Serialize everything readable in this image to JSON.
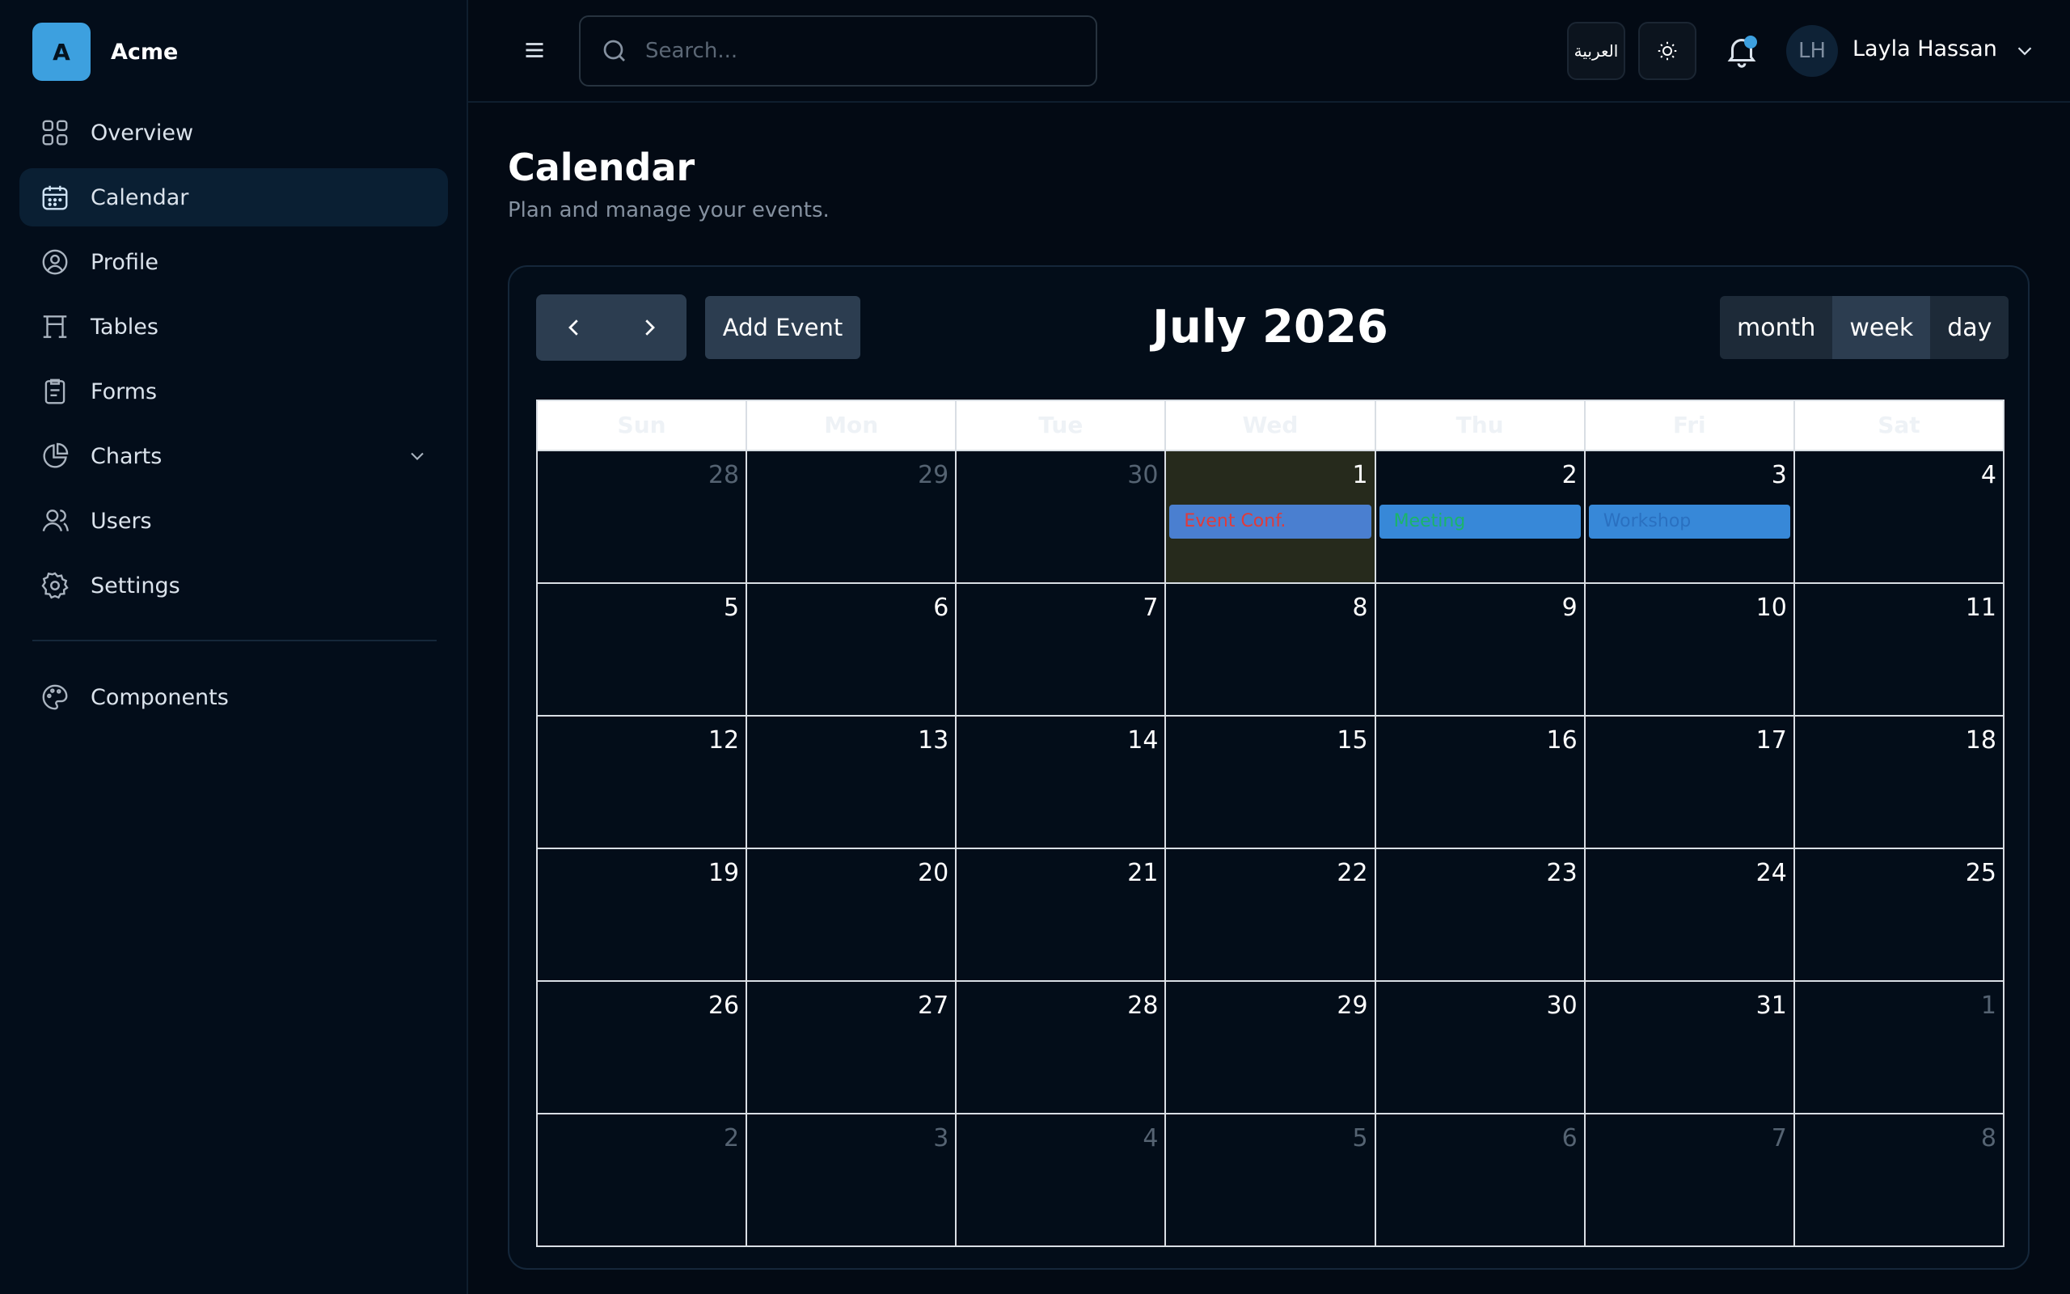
{
  "brand": {
    "logo_letter": "A",
    "name": "Acme",
    "color": "#3da0df"
  },
  "sidebar": {
    "items": [
      {
        "label": "Overview",
        "icon": "grid-icon"
      },
      {
        "label": "Calendar",
        "icon": "calendar-icon",
        "active": true
      },
      {
        "label": "Profile",
        "icon": "user-circle-icon"
      },
      {
        "label": "Tables",
        "icon": "table-icon"
      },
      {
        "label": "Forms",
        "icon": "clipboard-icon"
      },
      {
        "label": "Charts",
        "icon": "pie-chart-icon",
        "expandable": true
      },
      {
        "label": "Users",
        "icon": "users-icon"
      },
      {
        "label": "Settings",
        "icon": "gear-icon"
      }
    ],
    "secondary": [
      {
        "label": "Components",
        "icon": "palette-icon"
      }
    ]
  },
  "header": {
    "search_placeholder": "Search...",
    "language_label": "العربية",
    "theme_icon": "sun-icon",
    "notification_icon": "bell-icon",
    "avatar_initials": "LH",
    "user_name": "Layla Hassan"
  },
  "page": {
    "title": "Calendar",
    "subtitle": "Plan and manage your events."
  },
  "calendar": {
    "add_event_label": "Add Event",
    "month_title": "July 2026",
    "views": [
      "month",
      "week",
      "day"
    ],
    "active_view": "month",
    "weekdays": [
      "Sun",
      "Mon",
      "Tue",
      "Wed",
      "Thu",
      "Fri",
      "Sat"
    ],
    "weeks": [
      [
        {
          "n": "28",
          "other": true
        },
        {
          "n": "29",
          "other": true
        },
        {
          "n": "30",
          "other": true
        },
        {
          "n": "1",
          "today": true
        },
        {
          "n": "2"
        },
        {
          "n": "3"
        },
        {
          "n": "4"
        }
      ],
      [
        {
          "n": "5"
        },
        {
          "n": "6"
        },
        {
          "n": "7"
        },
        {
          "n": "8"
        },
        {
          "n": "9"
        },
        {
          "n": "10"
        },
        {
          "n": "11"
        }
      ],
      [
        {
          "n": "12"
        },
        {
          "n": "13"
        },
        {
          "n": "14"
        },
        {
          "n": "15"
        },
        {
          "n": "16"
        },
        {
          "n": "17"
        },
        {
          "n": "18"
        }
      ],
      [
        {
          "n": "19"
        },
        {
          "n": "20"
        },
        {
          "n": "21"
        },
        {
          "n": "22"
        },
        {
          "n": "23"
        },
        {
          "n": "24"
        },
        {
          "n": "25"
        }
      ],
      [
        {
          "n": "26"
        },
        {
          "n": "27"
        },
        {
          "n": "28"
        },
        {
          "n": "29"
        },
        {
          "n": "30"
        },
        {
          "n": "31"
        },
        {
          "n": "1",
          "other": true
        }
      ],
      [
        {
          "n": "2",
          "other": true
        },
        {
          "n": "3",
          "other": true
        },
        {
          "n": "4",
          "other": true
        },
        {
          "n": "5",
          "other": true
        },
        {
          "n": "6",
          "other": true
        },
        {
          "n": "7",
          "other": true
        },
        {
          "n": "8",
          "other": true
        }
      ]
    ],
    "events": [
      {
        "title": "Event Conf.",
        "week": 0,
        "day": 3,
        "text_color": "#e03b3b",
        "bg_color": "#4a7fd0"
      },
      {
        "title": "Meeting",
        "week": 0,
        "day": 4,
        "text_color": "#1bb56a",
        "bg_color": "#3788d8"
      },
      {
        "title": "Workshop",
        "week": 0,
        "day": 5,
        "text_color": "#2a70c0",
        "bg_color": "#3788d8"
      }
    ]
  }
}
